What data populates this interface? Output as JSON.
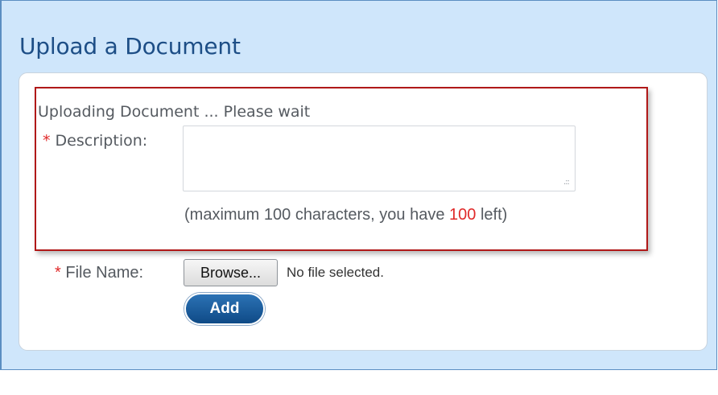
{
  "page": {
    "title": "Upload a Document"
  },
  "form": {
    "status_text": "Uploading Document ... Please wait",
    "required_marker": "*",
    "description": {
      "label": "Description:",
      "value": "",
      "resize_grip": ".::",
      "counter_prefix": "(maximum 100 characters, you have ",
      "counter_remaining": "100",
      "counter_suffix": " left)"
    },
    "file": {
      "label": "File Name:",
      "browse_label": "Browse...",
      "status": "No file selected."
    },
    "add_label": "Add"
  },
  "colors": {
    "frame_background": "#cfe6fb",
    "title": "#1d4e86",
    "highlight_border": "#b01818",
    "required_marker": "#e02a2a",
    "add_button": "#1a5d9e"
  }
}
